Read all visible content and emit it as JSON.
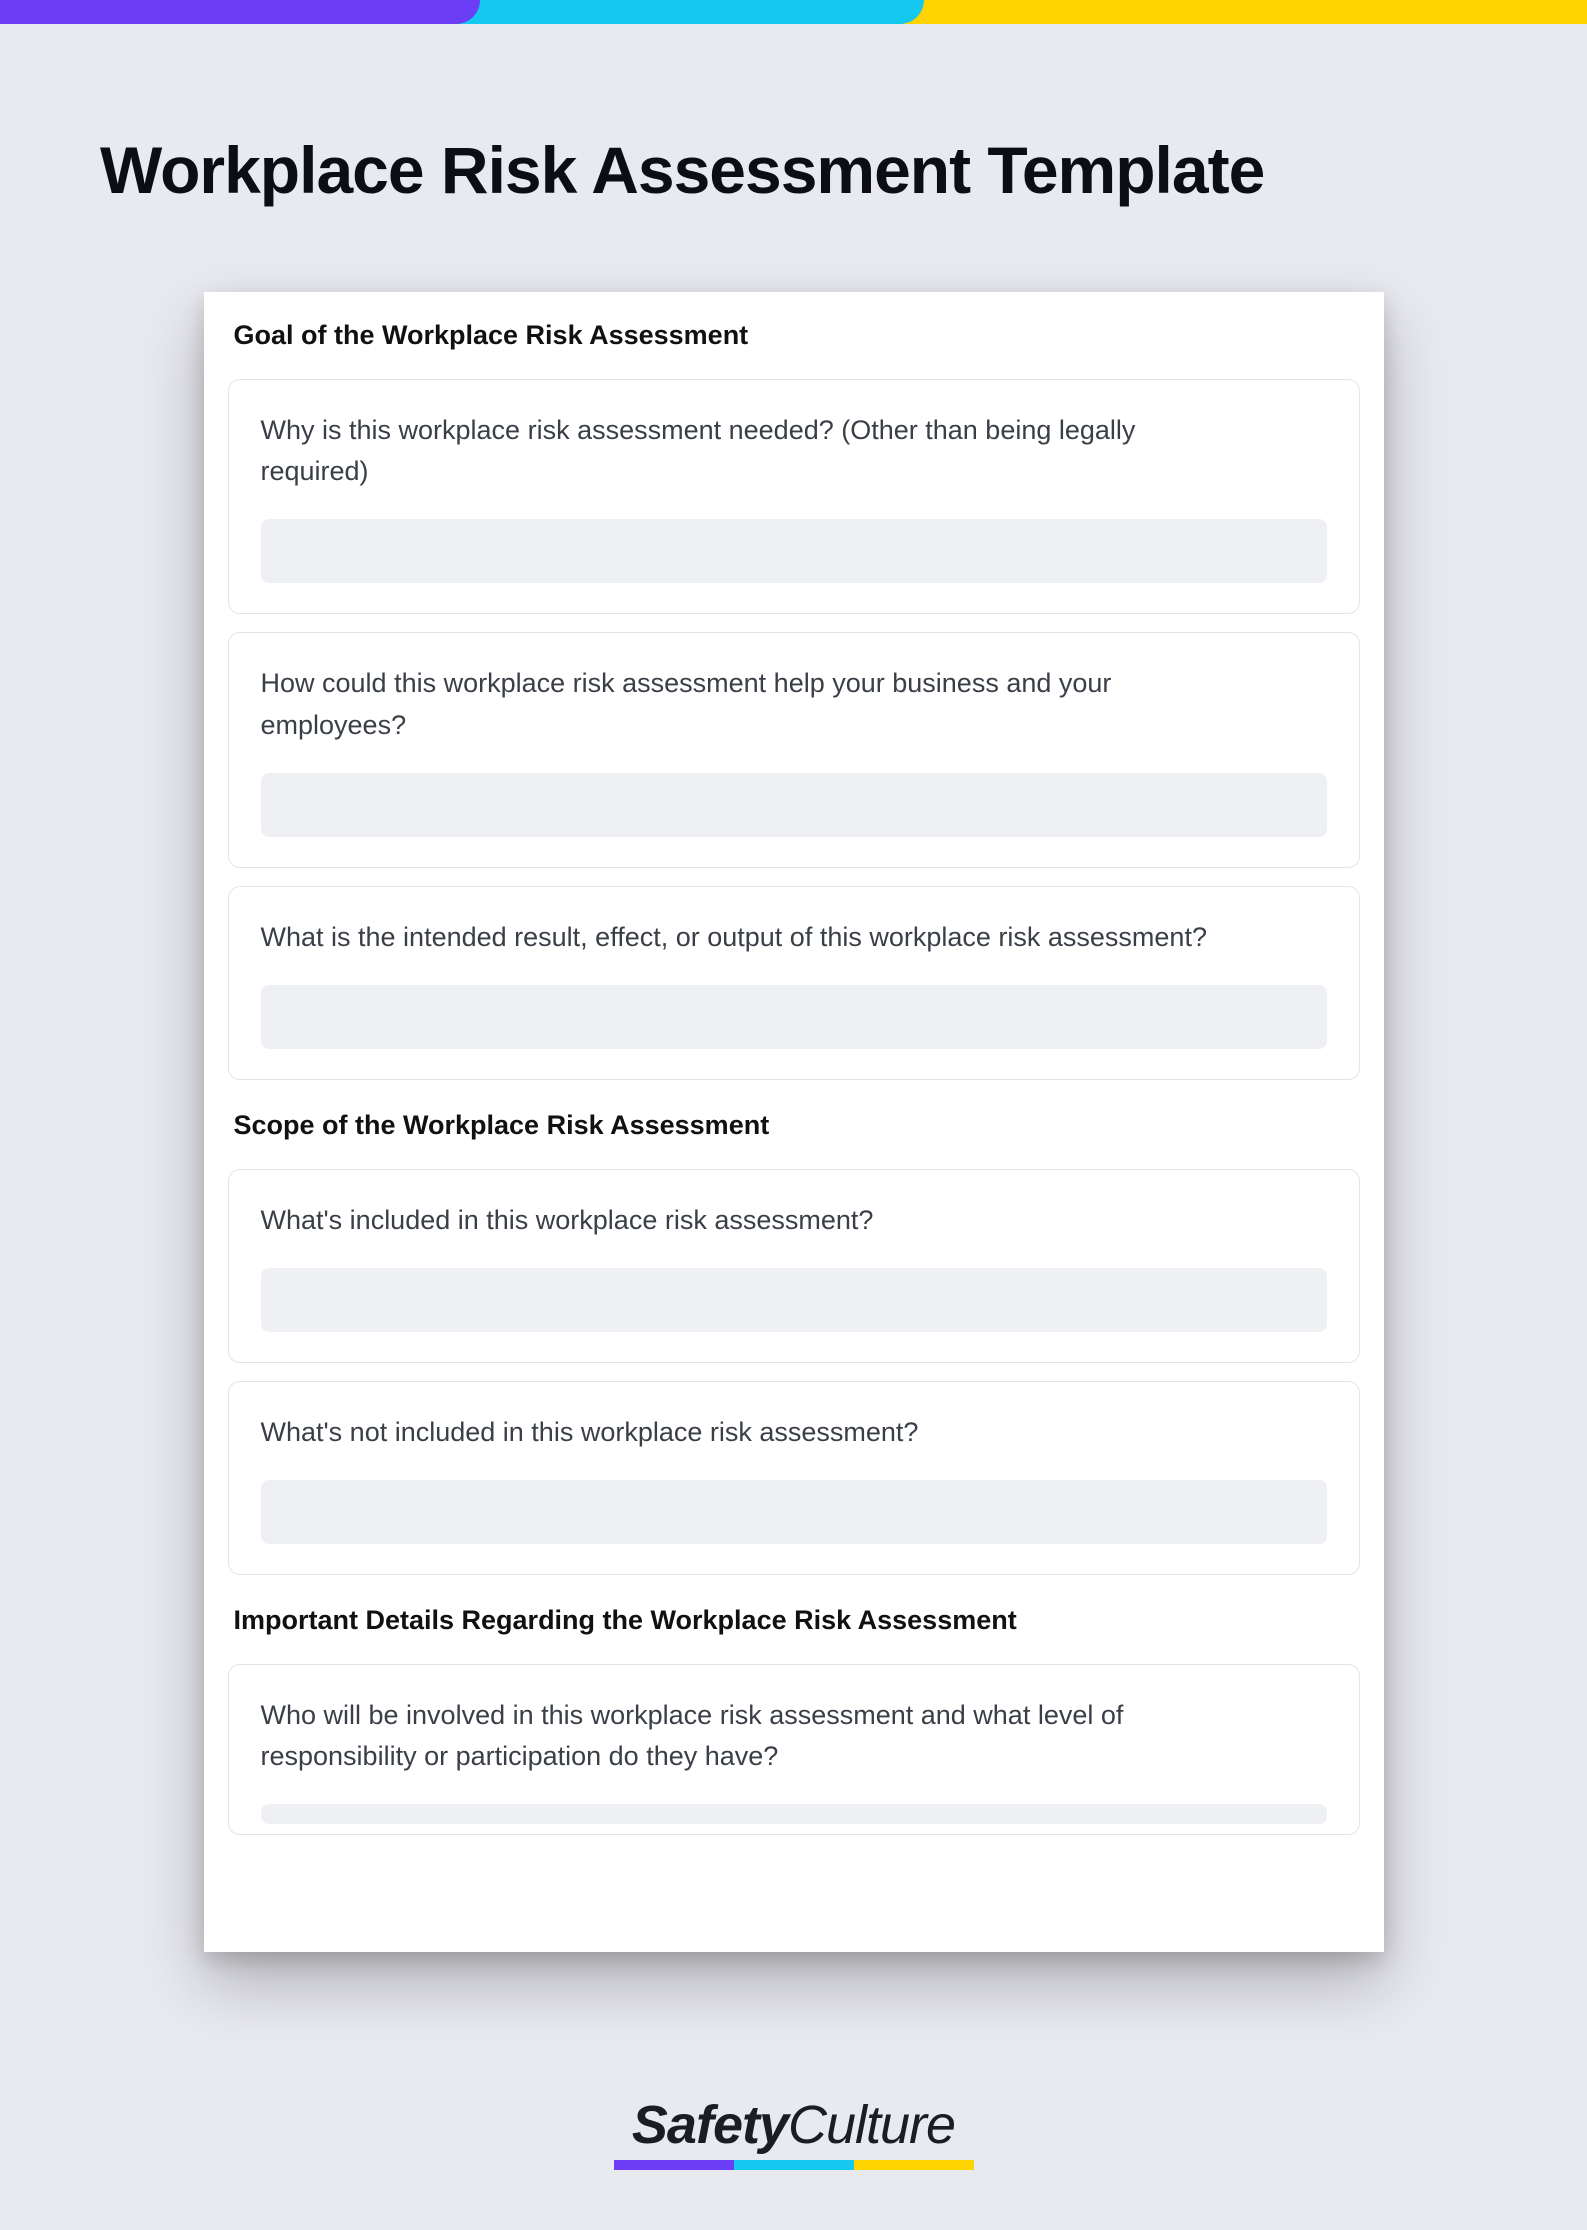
{
  "title": "Workplace Risk Assessment Template",
  "sections": [
    {
      "heading": "Goal of the Workplace Risk Assessment",
      "questions": [
        "Why is this workplace risk assessment needed? (Other than being legally required)",
        "How could this workplace risk assessment help your business and your employees?",
        "What is the intended result, effect, or output of this workplace risk assessment?"
      ]
    },
    {
      "heading": "Scope of the Workplace Risk Assessment",
      "questions": [
        "What's included in this workplace risk assessment?",
        "What's not included in this workplace risk assessment?"
      ]
    },
    {
      "heading": "Important Details Regarding the Workplace Risk Assessment",
      "questions": [
        "Who will be involved in this workplace risk assessment and what level of responsibility or participation do they have?"
      ]
    }
  ],
  "brand": {
    "bold": "Safety",
    "light": "Culture"
  },
  "colors": {
    "purple": "#6b3df5",
    "cyan": "#14c8f0",
    "yellow": "#ffd400"
  }
}
